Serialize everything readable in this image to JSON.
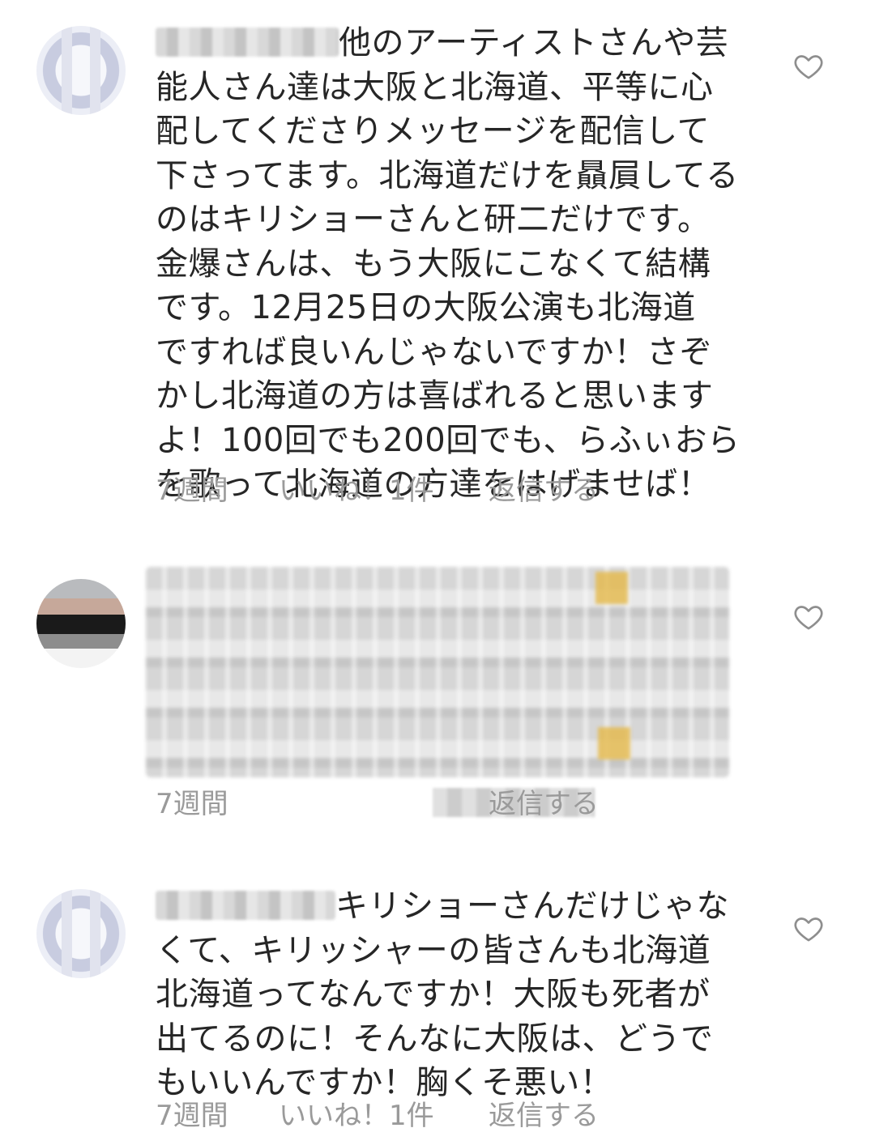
{
  "comments": [
    {
      "text": "他のアーティストさんや芸\n能人さん達は大阪と北海道、平等に心\n配してくださりメッセージを配信して\n下さってます。北海道だけを贔屓してる\nのはキリショーさんと研二だけです。\n金爆さんは、もう大阪にこなくて結構\nです。12月25日の大阪公演も北海道\nですれば良いんじゃないですか！さぞ\nかし北海道の方は喜ばれると思います\nよ！100回でも200回でも、らふぃおら\nを歌って北海道の方達をはげませば！",
      "time": "7週間",
      "likes": "いいね！1件",
      "reply": "返信する"
    },
    {
      "text": "",
      "time": "7週間",
      "likes": "",
      "reply": "返信する"
    },
    {
      "text": "キリショーさんだけじゃな\nくて、キリッシャーの皆さんも北海道\n北海道ってなんですか！大阪も死者が\n出てるのに！そんなに大阪は、どうで\nもいいんですか！胸くそ悪い！",
      "time": "7週間",
      "likes": "いいね！1件",
      "reply": "返信する"
    }
  ],
  "icons": {
    "like": "heart-outline-icon"
  }
}
